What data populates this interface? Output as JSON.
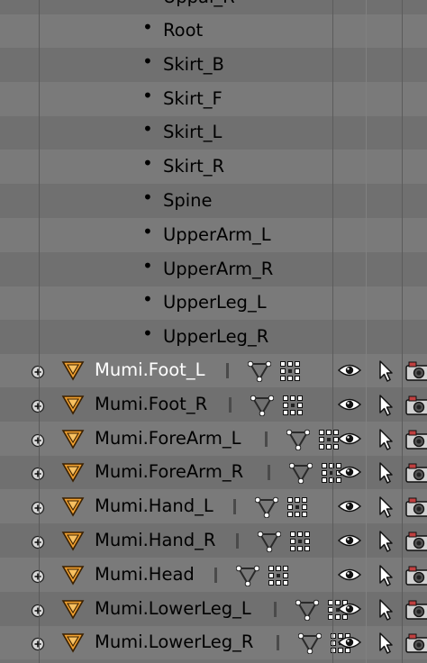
{
  "clipped_top_label": "Uppal_R",
  "bones": [
    "Root",
    "Skirt_B",
    "Skirt_F",
    "Skirt_L",
    "Skirt_R",
    "Spine",
    "UpperArm_L",
    "UpperArm_R",
    "UpperLeg_L",
    "UpperLeg_R"
  ],
  "objects": [
    {
      "label": "Mumi.Foot_L",
      "selected": true
    },
    {
      "label": "Mumi.Foot_R",
      "selected": false
    },
    {
      "label": "Mumi.ForeArm_L",
      "selected": false
    },
    {
      "label": "Mumi.ForeArm_R",
      "selected": false
    },
    {
      "label": "Mumi.Hand_L",
      "selected": false
    },
    {
      "label": "Mumi.Hand_R",
      "selected": false
    },
    {
      "label": "Mumi.Head",
      "selected": false
    },
    {
      "label": "Mumi.LowerLeg_L",
      "selected": false
    },
    {
      "label": "Mumi.LowerLeg_R",
      "selected": false
    }
  ],
  "icons": {
    "expand": "plus-expand-icon",
    "object": "mesh-object-icon",
    "modifier": "vertex-groups-icon",
    "data": "mesh-data-icon",
    "visibility": "eye-icon",
    "selectability": "cursor-icon",
    "render": "camera-icon"
  },
  "colors": {
    "mesh_orange": "#f0a030",
    "selected_text": "#ffffff",
    "camera_red": "#c04040"
  }
}
